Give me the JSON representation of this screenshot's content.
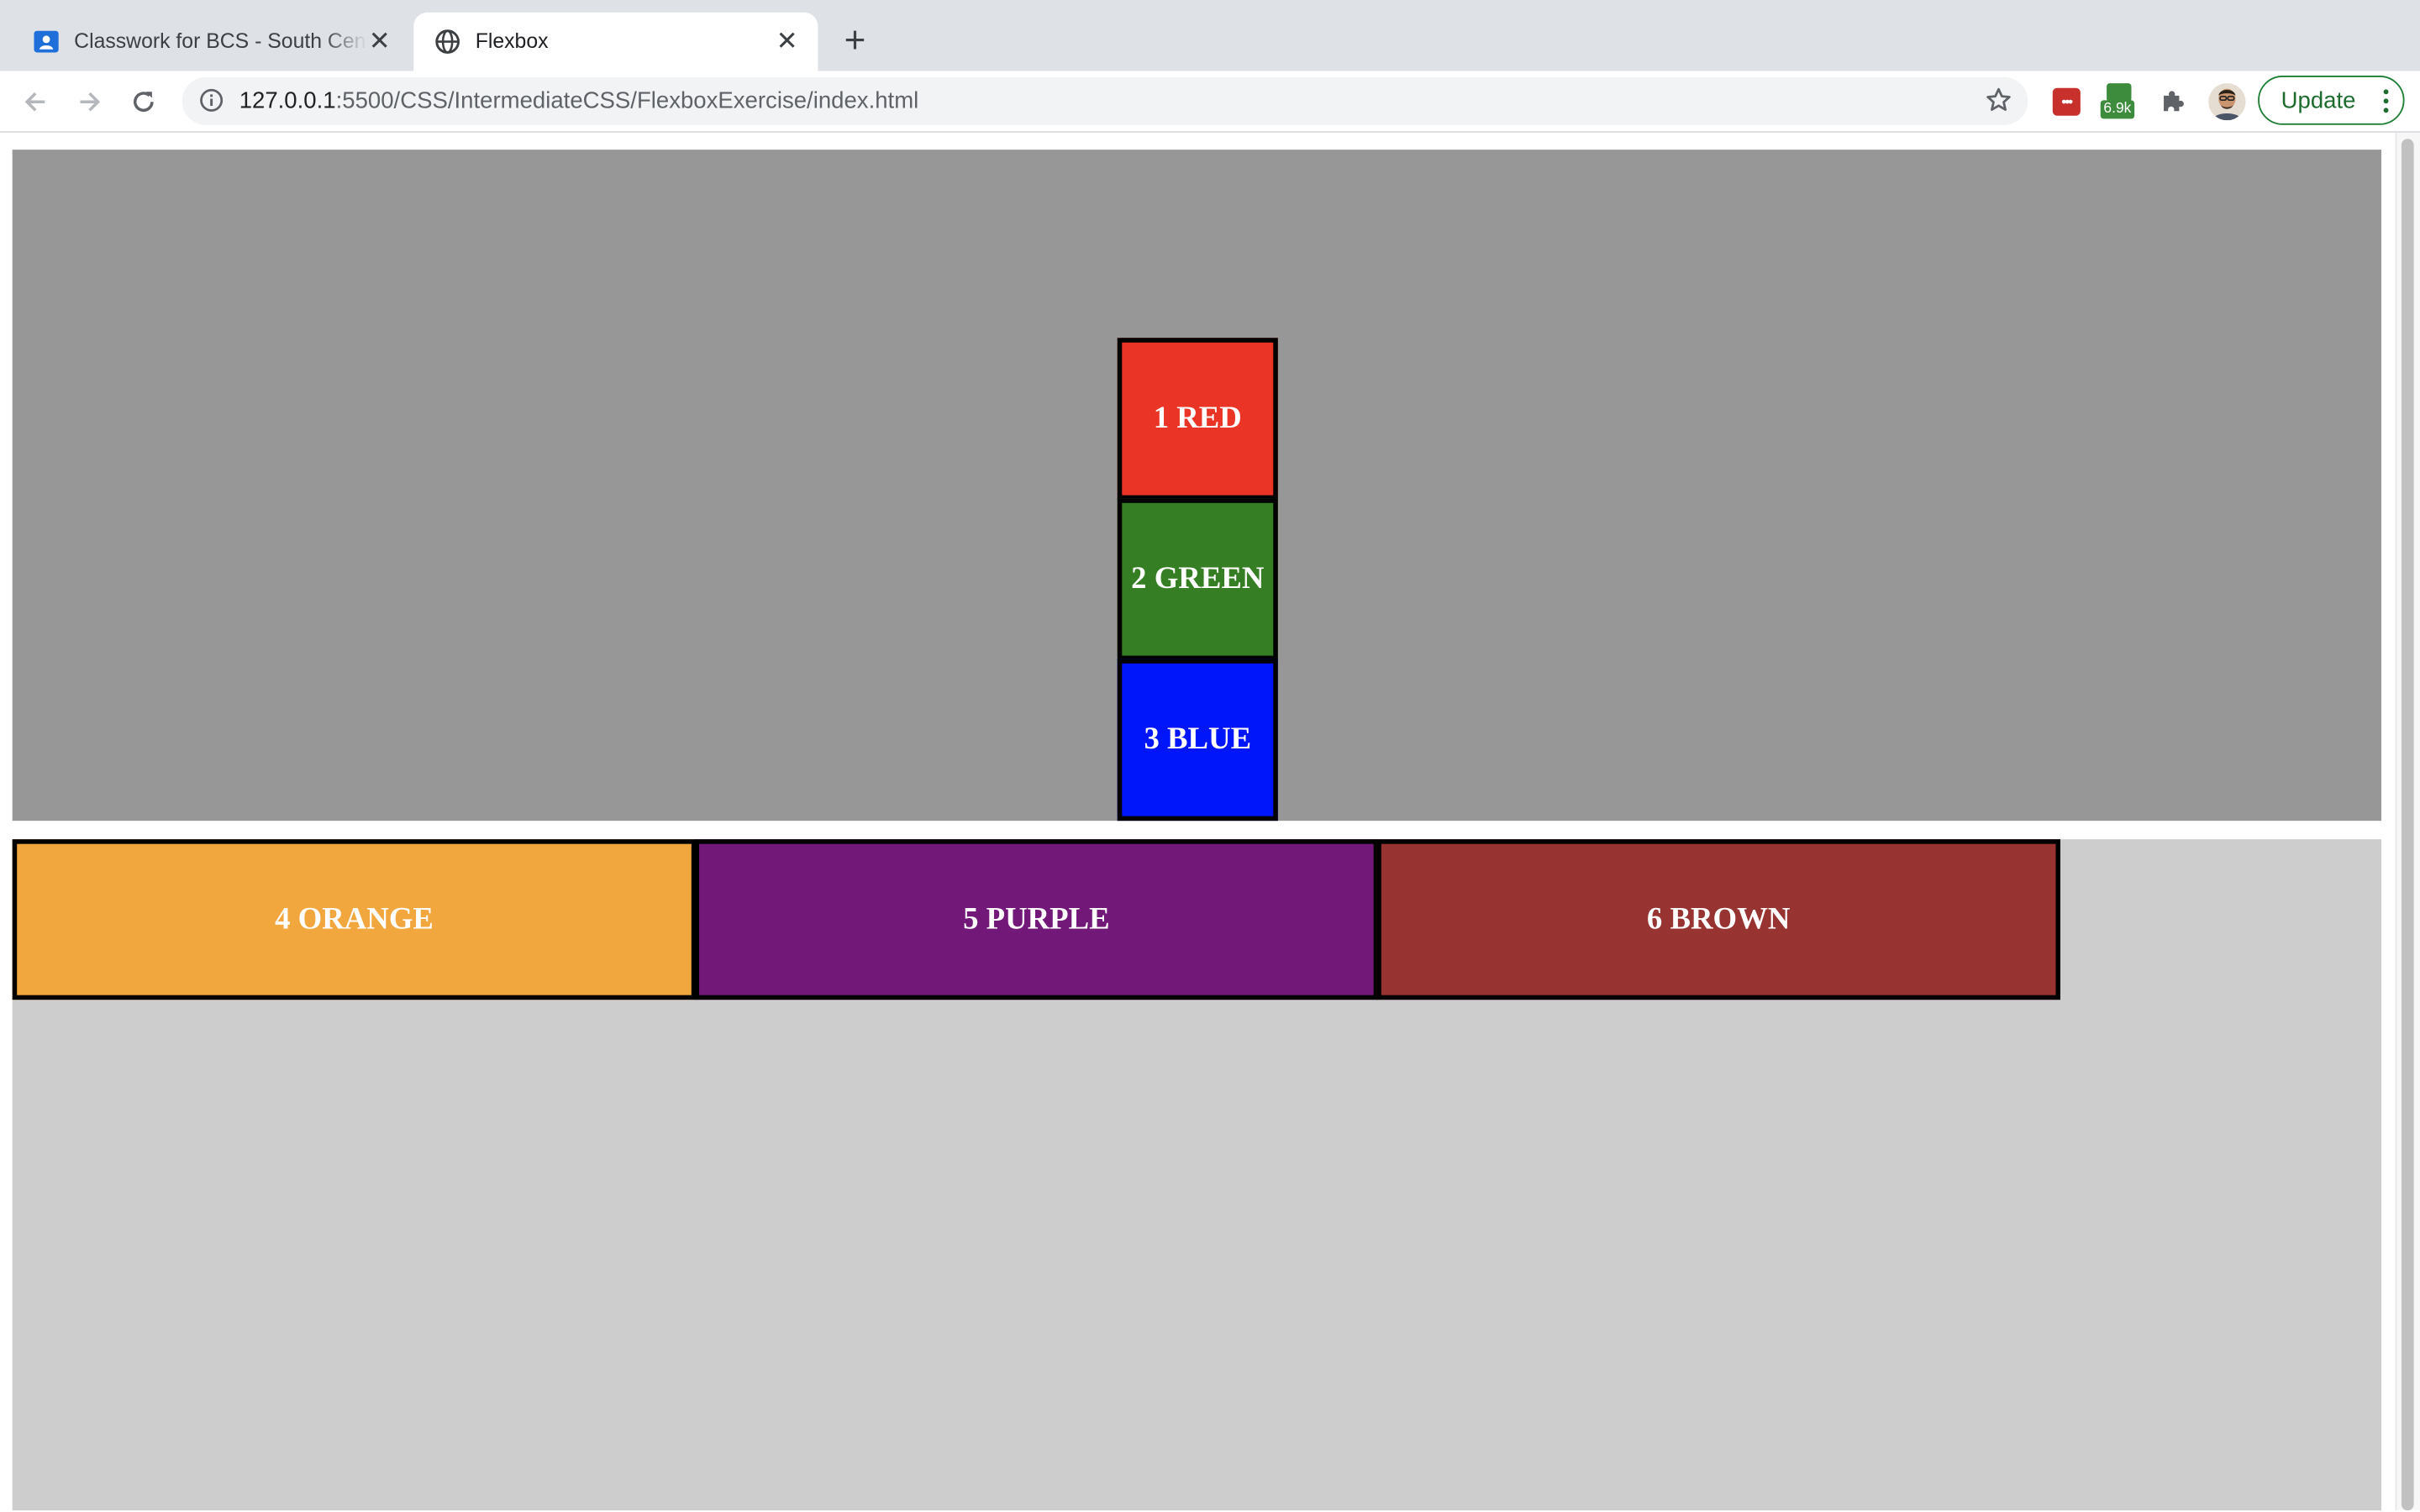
{
  "browser": {
    "tabs": [
      {
        "title": "Classwork for BCS - South Central",
        "active": false,
        "favicon": "classroom-icon"
      },
      {
        "title": "Flexbox",
        "active": true,
        "favicon": "globe-icon"
      }
    ],
    "url_host": "127.0.0.1",
    "url_rest": ":5500/CSS/IntermediateCSS/FlexboxExercise/index.html",
    "extension_badge": "6.9k",
    "update_label": "Update"
  },
  "page": {
    "container1_color": "#979797",
    "container2_color": "#cdcdcd",
    "boxes": [
      {
        "label": "1 RED",
        "color": "#e93426"
      },
      {
        "label": "2 GREEN",
        "color": "#367e23"
      },
      {
        "label": "3 BLUE",
        "color": "#0016fa"
      },
      {
        "label": "4 ORANGE",
        "color": "#f1a73d"
      },
      {
        "label": "5 PURPLE",
        "color": "#721879"
      },
      {
        "label": "6 BROWN",
        "color": "#973330"
      }
    ]
  }
}
